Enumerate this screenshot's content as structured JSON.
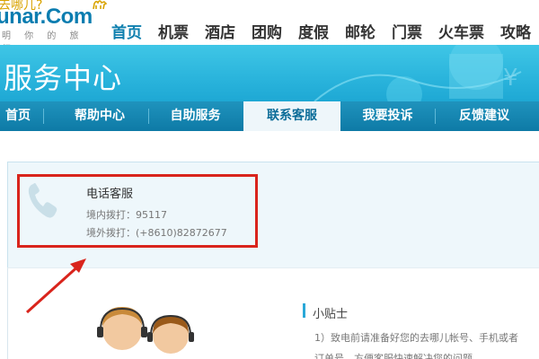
{
  "logo": {
    "cn_text": "去哪儿?",
    "main_text": "unar.Com",
    "slogan": "明 你 的 旅 行"
  },
  "main_nav": {
    "items": [
      {
        "label": "首页",
        "active": true
      },
      {
        "label": "机票",
        "active": false
      },
      {
        "label": "酒店",
        "active": false
      },
      {
        "label": "团购",
        "active": false
      },
      {
        "label": "度假",
        "active": false
      },
      {
        "label": "邮轮",
        "active": false
      },
      {
        "label": "门票",
        "active": false
      },
      {
        "label": "火车票",
        "active": false
      },
      {
        "label": "攻略",
        "active": false
      }
    ]
  },
  "banner": {
    "title": "服务中心"
  },
  "sub_nav": {
    "items": [
      {
        "label": "首页",
        "active": false
      },
      {
        "label": "帮助中心",
        "active": false
      },
      {
        "label": "自助服务",
        "active": false
      },
      {
        "label": "联系客服",
        "active": true
      },
      {
        "label": "我要投诉",
        "active": false
      },
      {
        "label": "反馈建议",
        "active": false
      }
    ]
  },
  "phone_service": {
    "title": "电话客服",
    "domestic": "境内拨打：95117",
    "international": "境外拨打：(+8610)82872677"
  },
  "tips": {
    "title": "小贴士",
    "line1": "1）致电前请准备好您的去哪儿帐号、手机或者",
    "line2": "订单号，方便客服快速解决您的问题。"
  },
  "colors": {
    "brand_blue": "#0d7fae",
    "banner_blue": "#2ab4dc",
    "highlight_red": "#d9241c",
    "logo_gold": "#d9a300"
  },
  "icons": [
    "camel-logo-icon",
    "phone-icon",
    "red-arrow-annotation",
    "customer-service-agents-illustration"
  ]
}
